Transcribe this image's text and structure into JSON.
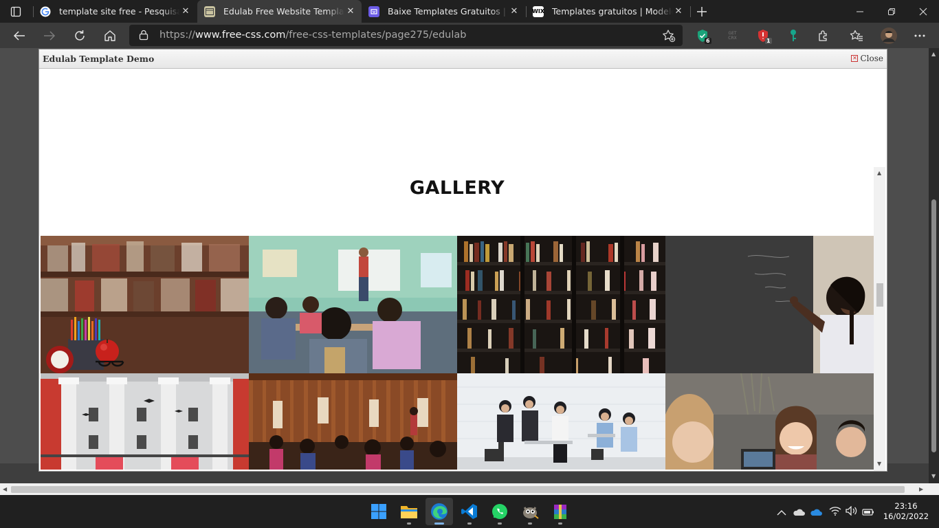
{
  "browser": {
    "tabs": [
      {
        "title": "template site free - Pesquisa Google",
        "favicon": "google-icon",
        "active": false
      },
      {
        "title": "Edulab Free Website Template | Free-CSS.com",
        "favicon": "free-css-icon",
        "active": true
      },
      {
        "title": "Baixe Templates Gratuitos | Download",
        "favicon": "templates-icon",
        "active": false
      },
      {
        "title": "Templates gratuitos | Modelos de sites",
        "favicon": "wix-icon",
        "active": false
      }
    ],
    "wix_favicon_text": "WIX",
    "address": {
      "prefix": "https://",
      "domain": "www.free-css.com",
      "path": "/free-css-templates/page275/edulab"
    },
    "extensions": [
      {
        "name": "shield-check-extension-icon",
        "badge": "6",
        "color": "#1aa37a"
      },
      {
        "name": "get-crx-extension-icon",
        "label": "GET CRX"
      },
      {
        "name": "red-shield-extension-icon",
        "badge": "1",
        "color": "#d63232"
      },
      {
        "name": "key-extension-icon",
        "color": "#17a58c"
      }
    ]
  },
  "demo": {
    "header_title": "Edulab Template Demo",
    "close_label": "Close",
    "section_title": "GALLERY",
    "gallery": [
      {
        "name": "books-and-apple-photo"
      },
      {
        "name": "classroom-teacher-photo"
      },
      {
        "name": "library-shelves-photo"
      },
      {
        "name": "student-chalkboard-photo"
      },
      {
        "name": "university-building-photo"
      },
      {
        "name": "rural-classroom-photo"
      },
      {
        "name": "students-group-photo"
      },
      {
        "name": "students-laptop-photo"
      }
    ]
  },
  "taskbar": {
    "apps": [
      {
        "name": "start-icon"
      },
      {
        "name": "file-explorer-icon"
      },
      {
        "name": "edge-icon",
        "active": true
      },
      {
        "name": "vscode-icon"
      },
      {
        "name": "whatsapp-icon"
      },
      {
        "name": "gimp-icon"
      },
      {
        "name": "winrar-icon"
      }
    ],
    "time": "23:16",
    "date": "16/02/2022"
  }
}
